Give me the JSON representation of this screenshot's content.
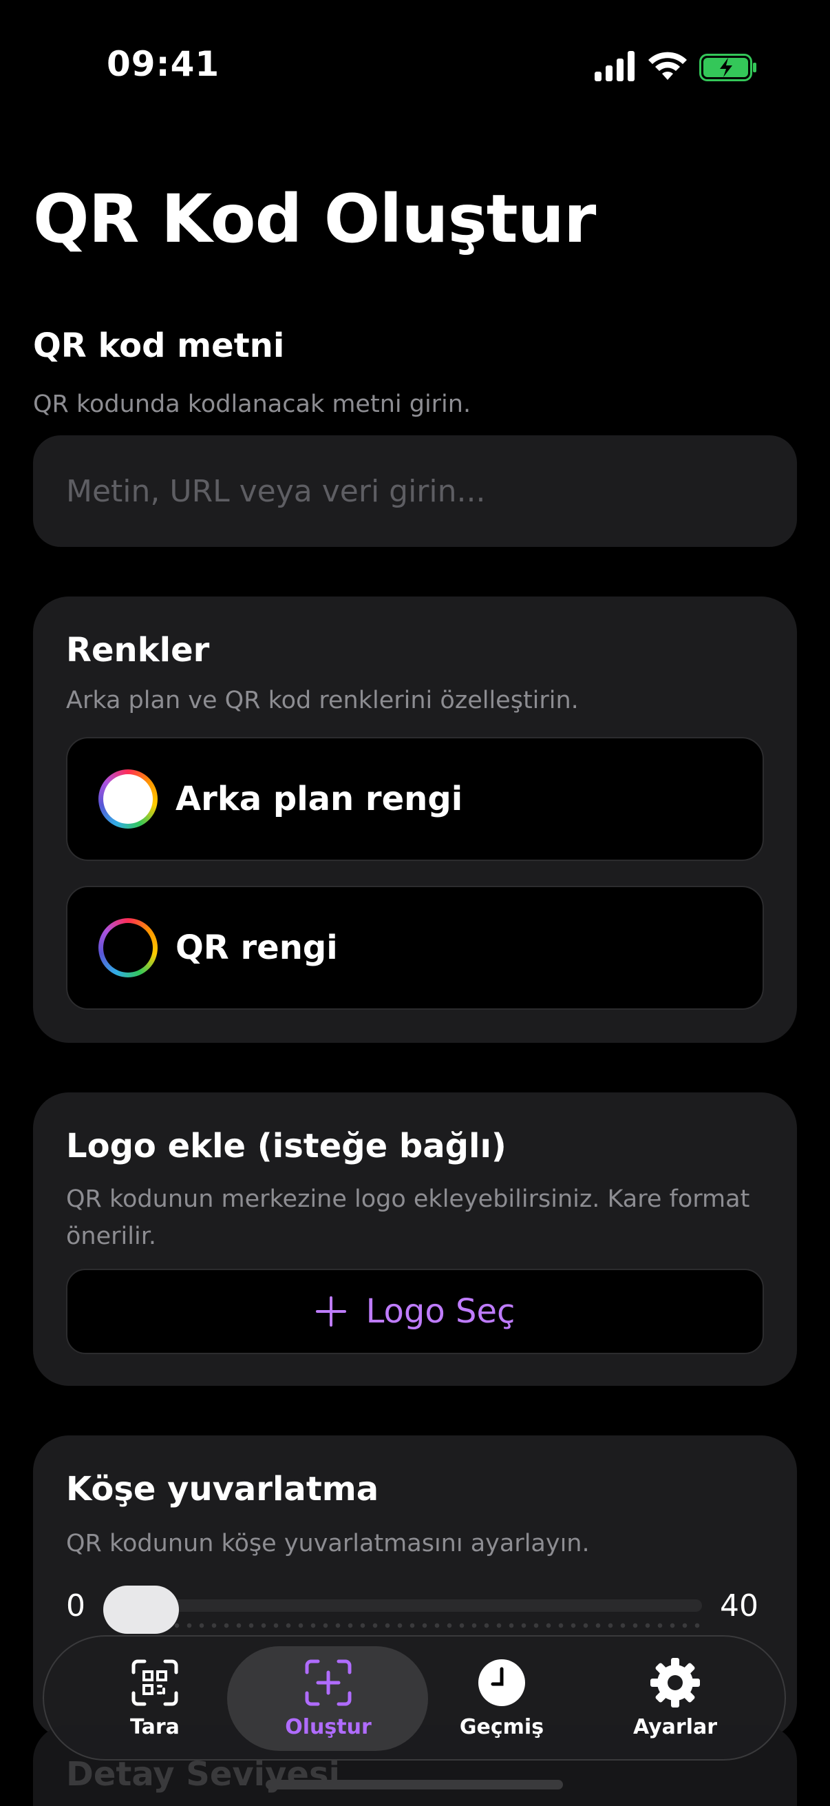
{
  "status_bar": {
    "time": "09:41"
  },
  "page_title": "QR Kod Oluştur",
  "text_section": {
    "title": "QR kod metni",
    "subtitle": "QR kodunda kodlanacak metni girin.",
    "input_value": "",
    "input_placeholder": "Metin, URL veya veri girin..."
  },
  "colors_section": {
    "title": "Renkler",
    "subtitle": "Arka plan ve QR kod renklerini özelleştirin.",
    "background_label": "Arka plan rengi",
    "background_color": "#ffffff",
    "qr_label": "QR rengi",
    "qr_color": "#000000"
  },
  "logo_section": {
    "title": "Logo ekle (isteğe bağlı)",
    "subtitle": "QR kodunun merkezine logo ekleyebilirsiniz. Kare format önerilir.",
    "button_icon": "plus-icon",
    "button_label": "Logo Seç"
  },
  "corner_section": {
    "title": "Köşe yuvarlatma",
    "subtitle": "QR kodunun köşe yuvarlatmasını ayarlayın.",
    "min_label": "0",
    "max_label": "40",
    "value": 0
  },
  "detail_section": {
    "title": "Detay Seviyesi"
  },
  "tab_bar": {
    "tabs": [
      {
        "label": "Tara",
        "icon": "qr-scan-icon",
        "active": false
      },
      {
        "label": "Oluştur",
        "icon": "qr-create-icon",
        "active": true
      },
      {
        "label": "Geçmiş",
        "icon": "clock-icon",
        "active": false
      },
      {
        "label": "Ayarlar",
        "icon": "gear-icon",
        "active": false
      }
    ]
  },
  "colors": {
    "accent": "#b06cff",
    "card": "#1c1c1e",
    "background": "#000000"
  }
}
